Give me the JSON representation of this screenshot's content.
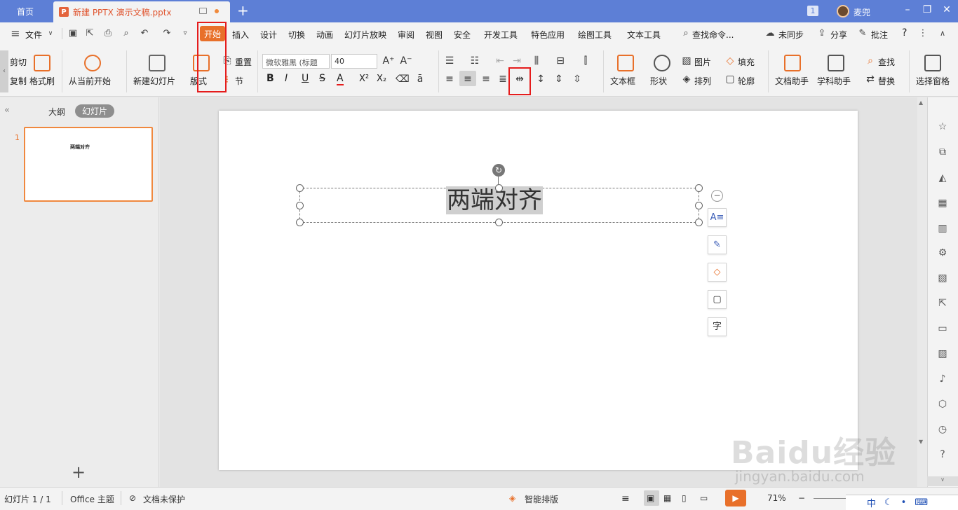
{
  "tabs": {
    "home": "首页",
    "doc": "新建 PPTX 演示文稿.pptx",
    "doc_icon": "P",
    "new_tab": "+"
  },
  "titlebar": {
    "badge": "1",
    "user": "麦兜"
  },
  "menu": {
    "file": "文件",
    "start": "开始",
    "items": [
      "插入",
      "设计",
      "切换",
      "动画",
      "幻灯片放映",
      "审阅",
      "视图",
      "安全",
      "开发工具",
      "特色应用",
      "绘图工具",
      "文本工具"
    ],
    "search": "查找命令...",
    "sync": "未同步",
    "share": "分享",
    "comment": "批注",
    "help": "?"
  },
  "ribbon": {
    "cut": "剪切",
    "copy": "复制",
    "format_painter": "格式刷",
    "from_current": "从当前开始",
    "new_slide": "新建幻灯片",
    "layout": "版式",
    "reset": "重置",
    "section": "节",
    "font_name": "微软雅黑 (标题",
    "font_size": "40",
    "bold": "B",
    "italic": "I",
    "underline": "U",
    "strike": "S",
    "font_color": "A",
    "superscript": "X²",
    "subscript": "X₂",
    "textbox": "文本框",
    "shape": "形状",
    "picture": "图片",
    "fill": "填充",
    "arrange": "排列",
    "outline": "轮廓",
    "doc_helper": "文档助手",
    "subject_helper": "学科助手",
    "find": "查找",
    "replace": "替换",
    "select_pane": "选择窗格"
  },
  "leftpanel": {
    "outline": "大纲",
    "slides": "幻灯片",
    "slide_number": "1",
    "thumb_title": "两端对齐",
    "add": "+"
  },
  "slide": {
    "title": "两端对齐"
  },
  "status": {
    "slide_info": "幻灯片 1 / 1",
    "theme": "Office 主题",
    "protect": "文档未保护",
    "smart_layout": "智能排版",
    "zoom": "71%"
  },
  "watermark": {
    "brand": "Baidu经验",
    "url": "jingyan.baidu.com"
  },
  "ime": {
    "lang": "中"
  },
  "colors": {
    "accent": "#e8702a",
    "tabbar": "#5d7fd6",
    "highlight_box": "#e51c1c"
  }
}
